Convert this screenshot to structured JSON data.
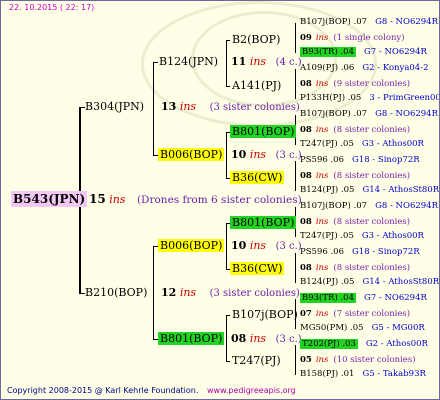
{
  "date": "22. 10.2015 ( 22: 17)",
  "footer": {
    "copyright": "Copyright 2008-2015 @ Karl Kehrle Foundation.",
    "url": "www.pedigreeapis.org"
  },
  "root": {
    "label": "B543(JPN)",
    "ins_count": "15",
    "ins_word": "ins",
    "note": "(Drones from 6 sister colonies)"
  },
  "gen1": [
    {
      "label": "B304(JPN)",
      "ins_count": "13",
      "ins_word": "ins",
      "note": "(3 sister colonies)"
    },
    {
      "label": "B210(BOP)",
      "ins_count": "12",
      "ins_word": "ins",
      "note": "(3 sister colonies)"
    }
  ],
  "gen2": [
    {
      "label": "B124(JPN)",
      "ins_count": "11",
      "ins_word": "ins",
      "note": "(4 c.)",
      "highlight": "none"
    },
    {
      "label": "B006(BOP)",
      "ins_count": "10",
      "ins_word": "ins",
      "note": "(3 c.)",
      "highlight": "yellow"
    },
    {
      "label": "B006(BOP)",
      "ins_count": "10",
      "ins_word": "ins",
      "note": "(3 c.)",
      "highlight": "yellow"
    },
    {
      "label": "B801(BOP)",
      "ins_count": "08",
      "ins_word": "ins",
      "note": "(3 c.)",
      "highlight": "green"
    }
  ],
  "gen3": [
    {
      "label": "B2(BOP)",
      "highlight": "none"
    },
    {
      "label": "A141(PJ)",
      "highlight": "none"
    },
    {
      "label": "B801(BOP)",
      "highlight": "green"
    },
    {
      "label": "B36(CW)",
      "highlight": "yellow"
    },
    {
      "label": "B801(BOP)",
      "highlight": "green"
    },
    {
      "label": "B36(CW)",
      "highlight": "yellow"
    },
    {
      "label": "B107j(BOP)",
      "highlight": "none"
    },
    {
      "label": "T247(PJ)",
      "highlight": "none"
    }
  ],
  "leaves": [
    {
      "name": "B107j(BOP) .07",
      "code": "G8 - NO6294R",
      "hl": "none"
    },
    {
      "name": "09",
      "ins": "ins",
      "rest": "(1 single colony)",
      "type": "ins"
    },
    {
      "name": "B93(TR) .04",
      "code": "G7 - NO6294R",
      "hl": "green"
    },
    {
      "name": "A109(PJ) .06",
      "code": "G2 - Konya04-2",
      "hl": "none"
    },
    {
      "name": "08",
      "ins": "ins",
      "rest": "(9 sister colonies)",
      "type": "ins"
    },
    {
      "name": "P133H(PJ) .05",
      "code": "3 - PrimGreen00",
      "hl": "none"
    },
    {
      "name": "B107j(BOP) .07",
      "code": "G8 - NO6294R",
      "hl": "none"
    },
    {
      "name": "08",
      "ins": "ins",
      "rest": "(8 sister colonies)",
      "type": "ins"
    },
    {
      "name": "T247(PJ) .05",
      "code": "G3 - Athos00R",
      "hl": "none"
    },
    {
      "name": "PS596 .06",
      "code": "G18 - Sinop72R",
      "hl": "none"
    },
    {
      "name": "08",
      "ins": "ins",
      "rest": "(8 sister colonies)",
      "type": "ins"
    },
    {
      "name": "B124(PJ) .05",
      "code": "G14 - AthosSt80R",
      "hl": "none"
    },
    {
      "name": "B107j(BOP) .07",
      "code": "G8 - NO6294R",
      "hl": "none"
    },
    {
      "name": "08",
      "ins": "ins",
      "rest": "(8 sister colonies)",
      "type": "ins"
    },
    {
      "name": "T247(PJ) .05",
      "code": "G3 - Athos00R",
      "hl": "none"
    },
    {
      "name": "PS596 .06",
      "code": "G18 - Sinop72R",
      "hl": "none"
    },
    {
      "name": "08",
      "ins": "ins",
      "rest": "(8 sister colonies)",
      "type": "ins"
    },
    {
      "name": "B124(PJ) .05",
      "code": "G14 - AthosSt80R",
      "hl": "none"
    },
    {
      "name": "B93(TR) .04",
      "code": "G7 - NO6294R",
      "hl": "green"
    },
    {
      "name": "07",
      "ins": "ins",
      "rest": "(7 sister colonies)",
      "type": "ins"
    },
    {
      "name": "MG50(PM) .05",
      "code": "G5 - MG00R",
      "hl": "none"
    },
    {
      "name": "T202(PJ) .03",
      "code": "G2 - Athos00R",
      "hl": "green"
    },
    {
      "name": "05",
      "ins": "ins",
      "rest": "(10 sister colonies)",
      "type": "ins"
    },
    {
      "name": "B158(PJ) .01",
      "code": "G5 - Takab93R",
      "hl": "none"
    }
  ]
}
